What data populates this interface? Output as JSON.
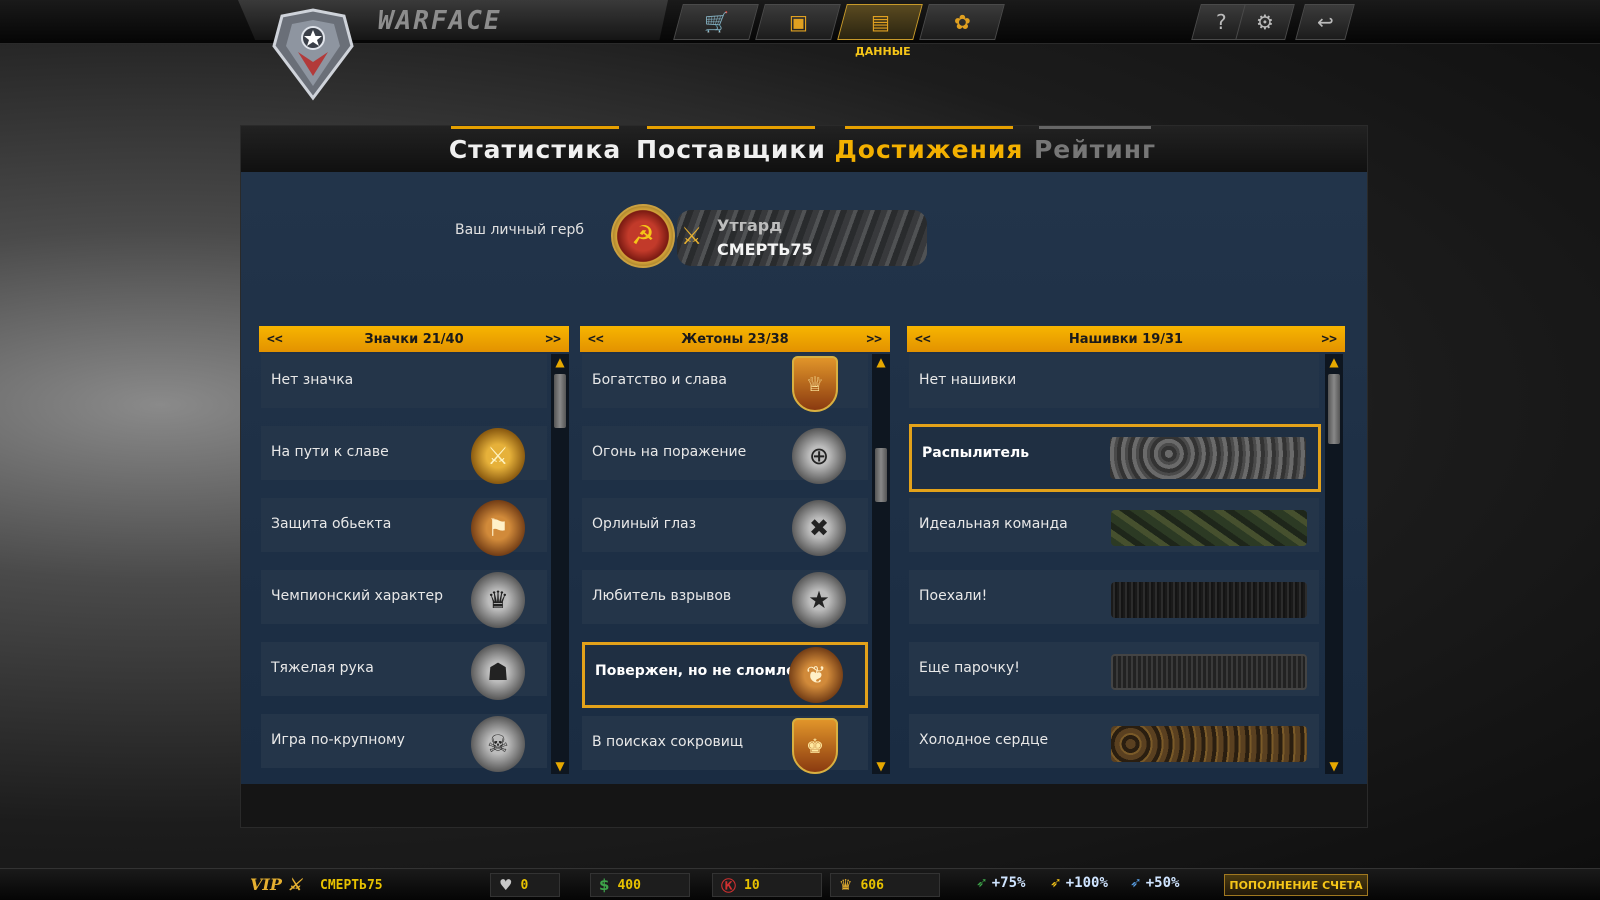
{
  "app": {
    "brand": "WARFACE"
  },
  "topnav": {
    "buttons": [
      {
        "icon": "cart-icon",
        "glyph": "🛒"
      },
      {
        "icon": "crate-icon",
        "glyph": "▣"
      },
      {
        "icon": "clipboard-icon",
        "glyph": "▤"
      },
      {
        "icon": "flower-icon",
        "glyph": "✿"
      }
    ],
    "active_label": "ДАННЫЕ",
    "system": [
      {
        "icon": "help-icon",
        "glyph": "?"
      },
      {
        "icon": "gear-icon",
        "glyph": "⚙"
      },
      {
        "icon": "exit-icon",
        "glyph": "↩"
      }
    ]
  },
  "tabs": [
    {
      "label": "Статистика",
      "state": "normal"
    },
    {
      "label": "Поставщики",
      "state": "normal"
    },
    {
      "label": "Достижения",
      "state": "active"
    },
    {
      "label": "Рейтинг",
      "state": "disabled"
    }
  ],
  "crest": {
    "label": "Ваш личный герб",
    "clan": "Утгард",
    "nick": "СМЕРТЬ75"
  },
  "columns": [
    {
      "title": "Значки 21/40",
      "prev": "<<",
      "next": ">>",
      "items": [
        {
          "name": "Нет значка",
          "icon": "none"
        },
        {
          "name": "На пути к славе",
          "icon": "lions-sword-icon",
          "glyph": "⚔"
        },
        {
          "name": "Защита обьекта",
          "icon": "flag-icon",
          "glyph": "⚑"
        },
        {
          "name": "Чемпионский характер",
          "icon": "trophy-icon",
          "glyph": "♛"
        },
        {
          "name": "Тяжелая рука",
          "icon": "soldier-icon",
          "glyph": "☗"
        },
        {
          "name": "Игра по-крупному",
          "icon": "beast-shield-icon",
          "glyph": "☠"
        }
      ]
    },
    {
      "title": "Жетоны 23/38",
      "prev": "<<",
      "next": ">>",
      "items": [
        {
          "name": "Богатство и слава",
          "icon": "crowned-shield-icon",
          "glyph": "♕"
        },
        {
          "name": "Огонь на поражение",
          "icon": "crosshair-icon",
          "glyph": "⊕"
        },
        {
          "name": "Орлиный глаз",
          "icon": "crossed-medal-icon",
          "glyph": "✖"
        },
        {
          "name": "Любитель взрывов",
          "icon": "star-medal-icon",
          "glyph": "★"
        },
        {
          "name": "Повержен, но не сломлен",
          "icon": "eagle-icon",
          "glyph": "❦"
        },
        {
          "name": "В поисках сокровищ",
          "icon": "crowned-crest-icon",
          "glyph": "♚"
        }
      ]
    },
    {
      "title": "Нашивки 19/31",
      "prev": "<<",
      "next": ">>",
      "items": [
        {
          "name": "Нет нашивки",
          "icon": "none"
        },
        {
          "name": "Распылитель",
          "icon": "rock-stripe"
        },
        {
          "name": "Идеальная команда",
          "icon": "camo-stripe"
        },
        {
          "name": "Поехали!",
          "icon": "asphalt-stripe"
        },
        {
          "name": "Еще парочку!",
          "icon": "metal-stripe"
        },
        {
          "name": "Холодное сердце",
          "icon": "gears-stripe"
        }
      ]
    }
  ],
  "status": {
    "vip": "VIP",
    "nick": "СМЕРТЬ75",
    "medals": "0",
    "money": "400",
    "kredits": "10",
    "crowns": "606",
    "xp_bonus": "+75%",
    "money_bonus": "+100%",
    "vp_bonus": "+50%",
    "topup": "ПОПОЛНЕНИЕ СЧЕТА"
  },
  "colors": {
    "accent": "#f3b000",
    "panel": "#22344a",
    "selected_border": "#e3a21a"
  }
}
